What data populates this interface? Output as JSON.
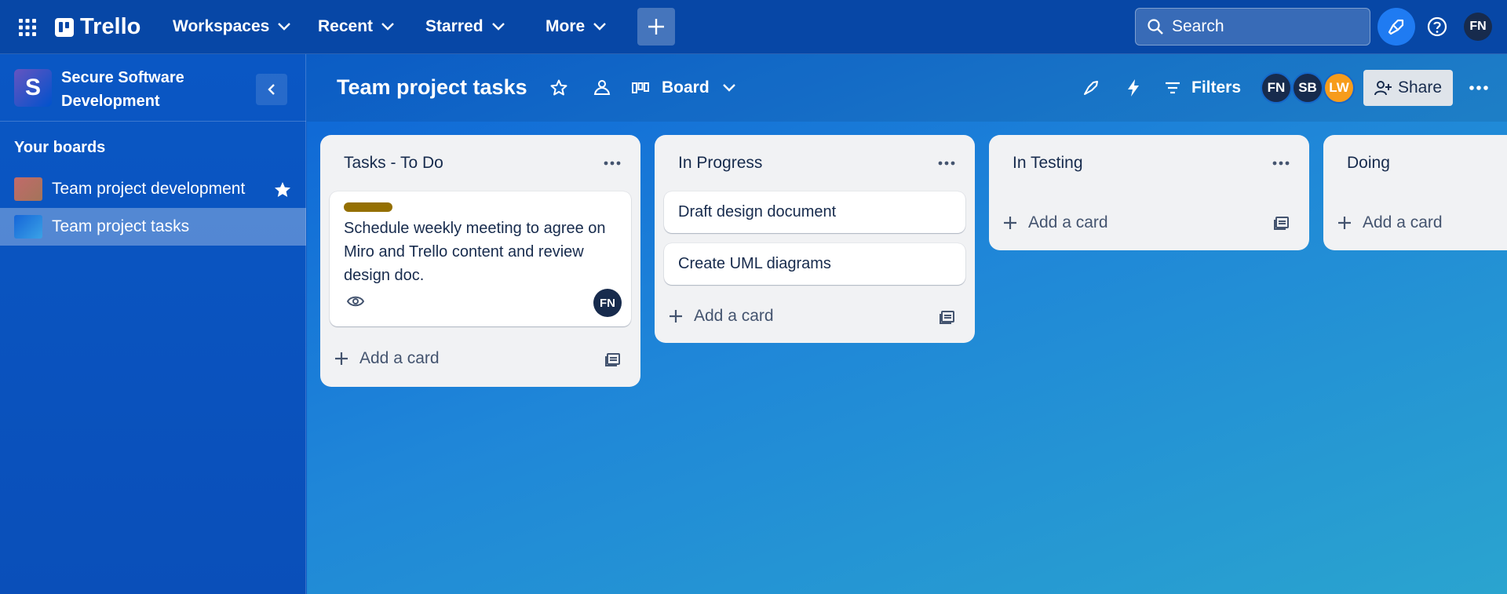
{
  "app": {
    "logo_text": "Trello",
    "nav": {
      "workspaces": "Workspaces",
      "recent": "Recent",
      "starred": "Starred",
      "more": "More"
    },
    "search_placeholder": "Search",
    "user_initials": "FN"
  },
  "sidebar": {
    "workspace_initial": "S",
    "workspace_name": "Secure Software Development",
    "your_boards_label": "Your boards",
    "boards": [
      {
        "name": "Team project development",
        "starred": true,
        "thumb_color": "#c26a6a"
      },
      {
        "name": "Team project tasks",
        "starred": false,
        "thumb_color": "#2f7fd9",
        "active": true
      }
    ]
  },
  "board": {
    "title": "Team project tasks",
    "view": "Board",
    "filters_label": "Filters",
    "share_label": "Share",
    "members": [
      {
        "initials": "FN",
        "color": "#172b4d"
      },
      {
        "initials": "SB",
        "color": "#172b4d"
      },
      {
        "initials": "LW",
        "color": "#f79c1b"
      }
    ]
  },
  "lists": [
    {
      "title": "Tasks - To Do",
      "cards": [
        {
          "label_color": "#946f00",
          "text": "Schedule weekly meeting to agree on Miro and Trello content and review design doc.",
          "member": "FN",
          "watching": true
        }
      ],
      "add_card_label": "Add a card"
    },
    {
      "title": "In Progress",
      "cards": [
        {
          "text": "Draft design document"
        },
        {
          "text": "Create UML diagrams"
        }
      ],
      "add_card_label": "Add a card"
    },
    {
      "title": "In Testing",
      "cards": [],
      "add_card_label": "Add a card"
    },
    {
      "title": "Doing",
      "cards": [],
      "add_card_label": "Add a card"
    }
  ]
}
